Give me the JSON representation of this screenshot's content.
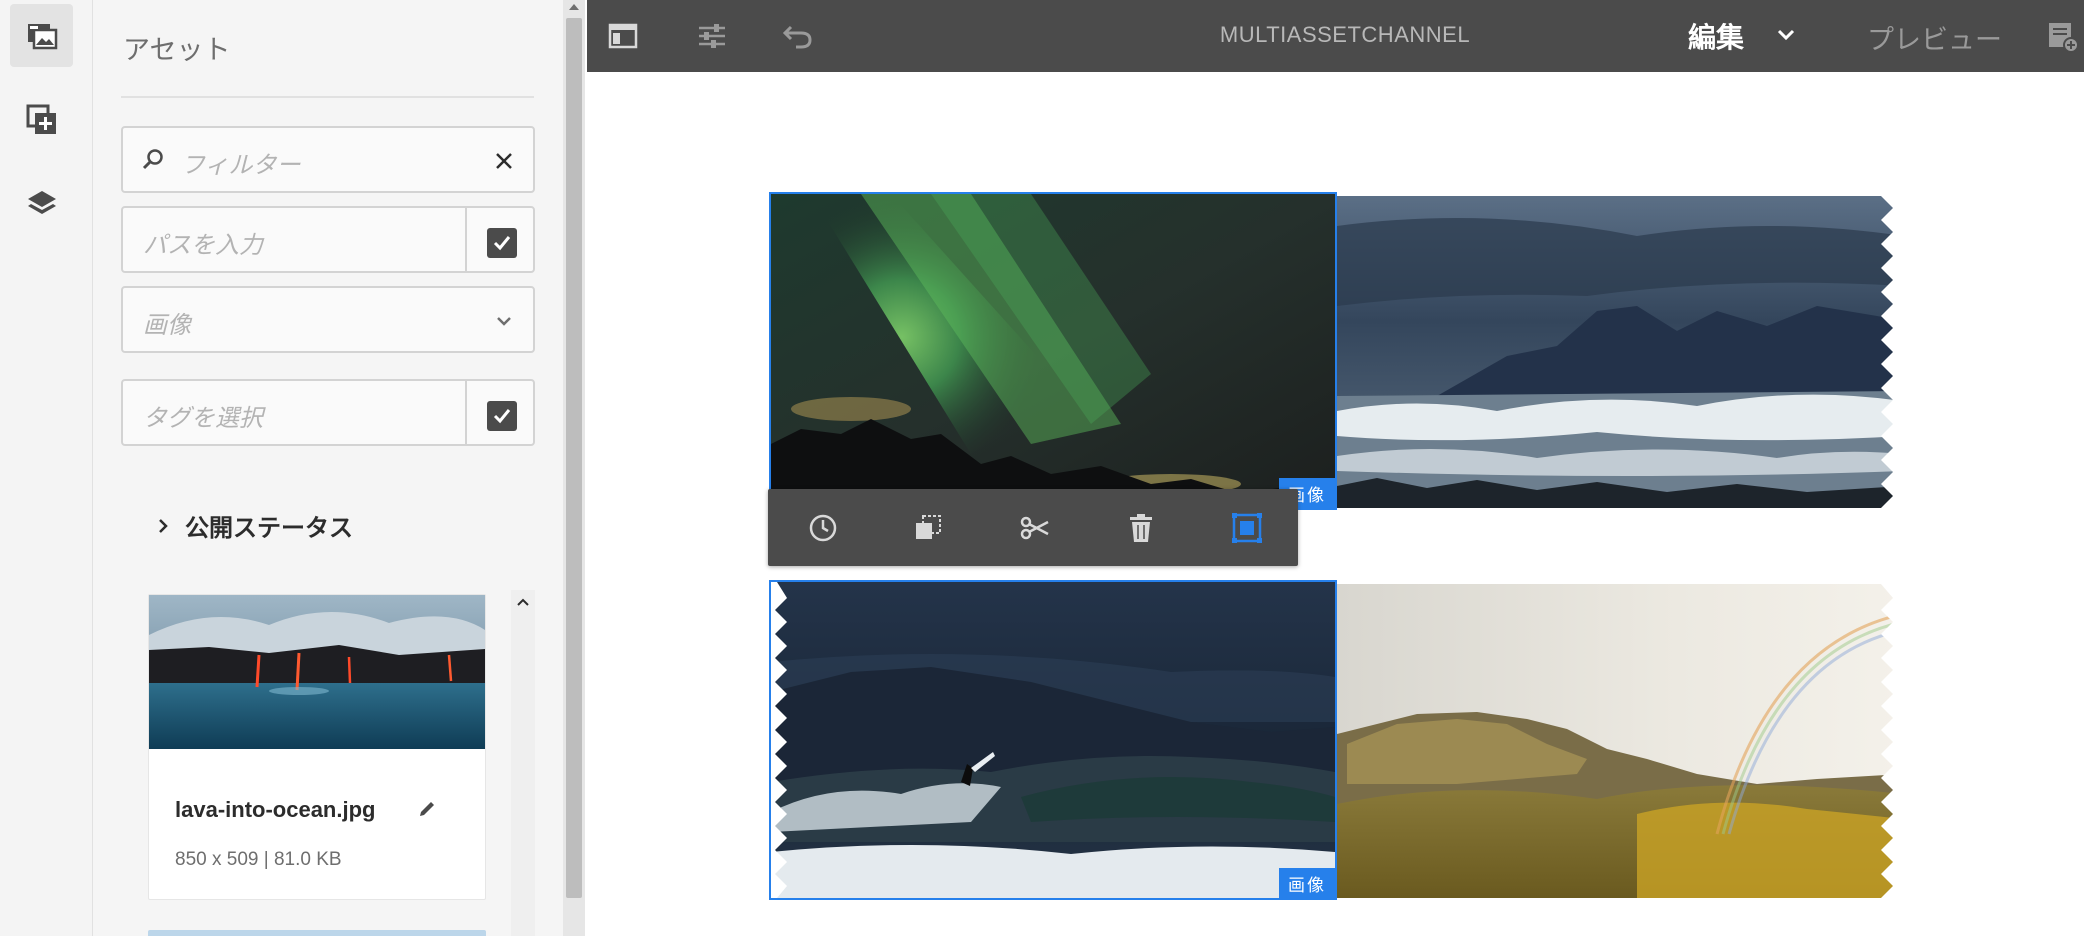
{
  "rail": {
    "items": [
      {
        "icon": "assets-icon",
        "active": true
      },
      {
        "icon": "components-icon",
        "active": false
      },
      {
        "icon": "layers-icon",
        "active": false
      }
    ]
  },
  "panel": {
    "title": "アセット",
    "filter": {
      "placeholder": "フィルター"
    },
    "path": {
      "placeholder": "パスを入力"
    },
    "type_select": {
      "value": "画像"
    },
    "tags": {
      "placeholder": "タグを選択"
    },
    "publish_status_label": "公開ステータス",
    "assets": [
      {
        "name": "lava-into-ocean.jpg",
        "meta": "850 x 509 | 81.0 KB"
      }
    ]
  },
  "topbar": {
    "title": "MULTIASSETCHANNEL",
    "mode": "編集",
    "preview": "プレビュー"
  },
  "canvas": {
    "badge_label": "画像"
  },
  "colors": {
    "accent": "#2680eb",
    "topbar": "#4b4b4b",
    "panel": "#f5f5f5"
  }
}
